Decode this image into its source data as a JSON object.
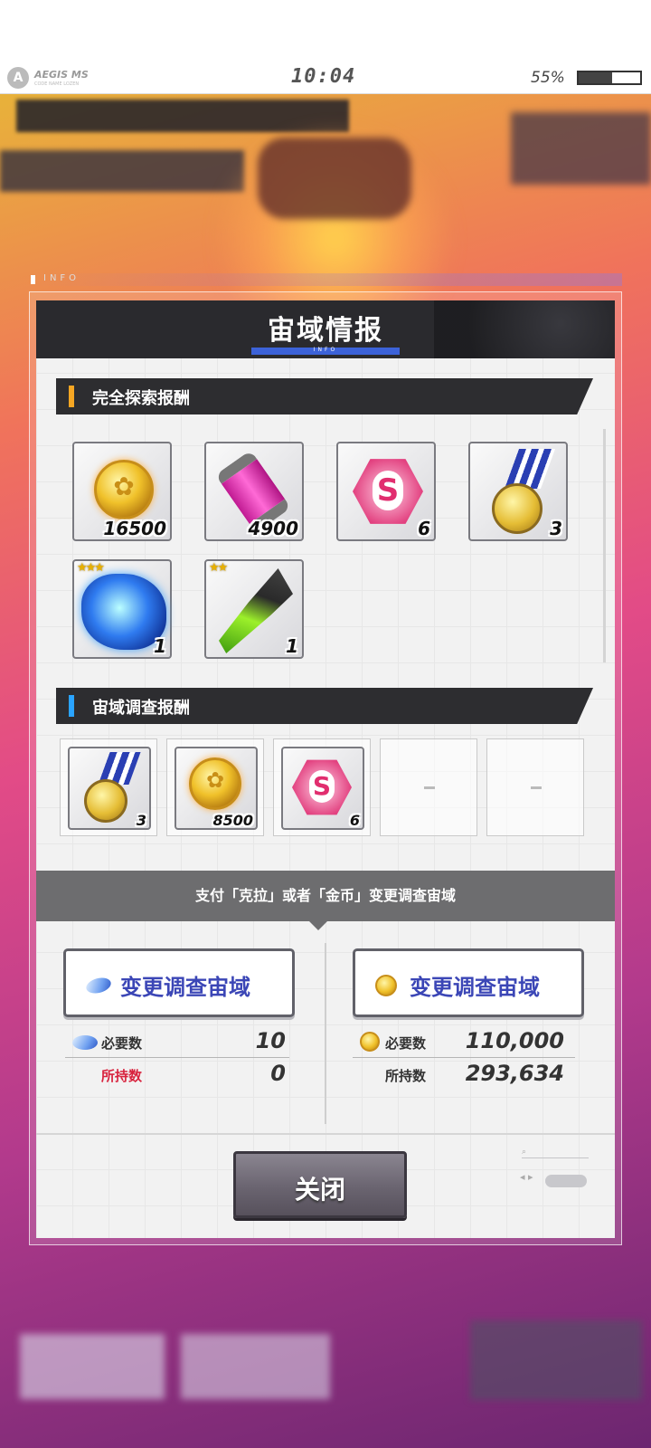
{
  "status_bar": {
    "brand": "AEGIS MS",
    "brand_sub": "CODE NAME LOZEN",
    "time": "10:04",
    "battery_percent": "55%",
    "battery_level": 0.55
  },
  "info_label": "INFO",
  "dialog": {
    "title": "宙域情报",
    "title_sub": "INFO",
    "full_exploration": {
      "heading": "完全探索报酬",
      "accent_color": "#f5a623",
      "items": [
        {
          "icon": "coin-icon",
          "qty": "16500"
        },
        {
          "icon": "energy-tube-icon",
          "qty": "4900"
        },
        {
          "icon": "s-hexagon-icon",
          "qty": "6"
        },
        {
          "icon": "medal-icon",
          "qty": "3"
        },
        {
          "icon": "blue-shell-icon",
          "qty": "1",
          "stars": "★★★"
        },
        {
          "icon": "green-shell-icon",
          "qty": "1",
          "stars": "★★"
        }
      ]
    },
    "investigation": {
      "heading": "宙域调查报酬",
      "accent_color": "#2aa4ff",
      "slots": [
        {
          "icon": "medal-icon",
          "qty": "3"
        },
        {
          "icon": "coin-icon",
          "qty": "8500"
        },
        {
          "icon": "s-hexagon-icon",
          "qty": "6"
        },
        {
          "empty": true
        },
        {
          "empty": true
        }
      ]
    },
    "payment_note": "支付「克拉」或者「金币」变更调查宙域",
    "left": {
      "button_label": "变更调查宙域",
      "required_label": "必要数",
      "required_value": "10",
      "owned_label": "所持数",
      "owned_value": "0"
    },
    "right": {
      "button_label": "变更调查宙域",
      "required_label": "必要数",
      "required_value": "110,000",
      "owned_label": "所持数",
      "owned_value": "293,634"
    },
    "close_label": "关闭"
  }
}
